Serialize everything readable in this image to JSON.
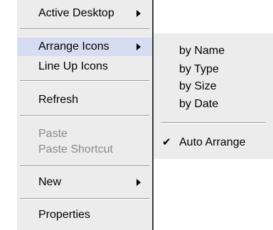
{
  "main_menu": {
    "active_desktop": "Active Desktop",
    "arrange_icons": "Arrange Icons",
    "line_up_icons": "Line Up Icons",
    "refresh": "Refresh",
    "paste": "Paste",
    "paste_shortcut": "Paste Shortcut",
    "new": "New",
    "properties": "Properties"
  },
  "sub_menu": {
    "by_name": "by Name",
    "by_type": "by Type",
    "by_size": "by Size",
    "by_date": "by Date",
    "auto_arrange": "Auto Arrange",
    "auto_arrange_checked": true
  },
  "icons": {
    "submenu_arrow": "chevron-right-icon",
    "check": "check-icon"
  },
  "colors": {
    "menu_bg": "#ececec",
    "highlight_bg": "#d6dcf2",
    "disabled_text": "#8a8a8a"
  }
}
